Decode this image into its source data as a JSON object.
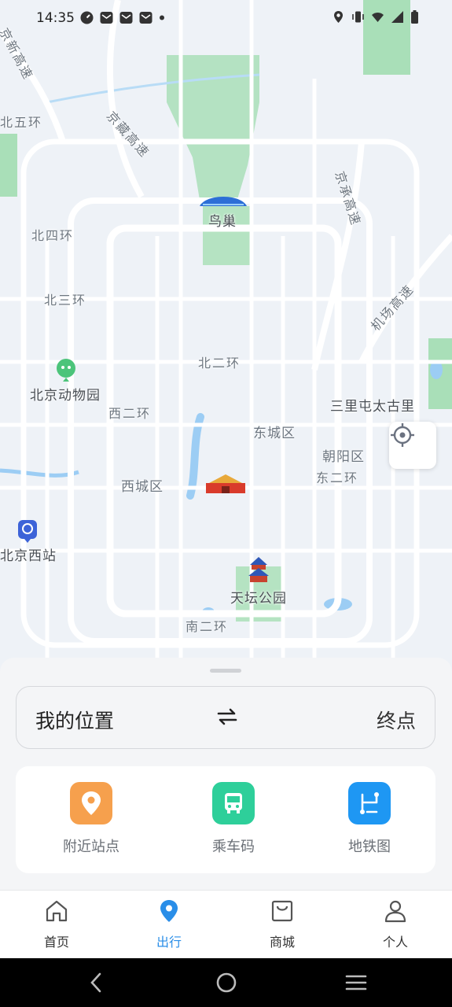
{
  "status_bar": {
    "time": "14:35",
    "left_icons": [
      "speedometer-icon",
      "mail-icon",
      "mail-icon",
      "mail-icon",
      "dot-icon"
    ],
    "right_icons": [
      "location-icon",
      "vibrate-icon",
      "wifi-icon",
      "signal-icon",
      "battery-icon"
    ]
  },
  "map": {
    "labels": {
      "bird_nest": "鸟巢",
      "zoo": "北京动物园",
      "dongcheng": "东城区",
      "xicheng": "西城区",
      "chaoyang": "朝阳区",
      "sanlitun": "三里屯太古里",
      "west_station": "北京西站",
      "temple_heaven": "天坛公园"
    },
    "roads": {
      "north5": "北五环",
      "north4": "北四环",
      "north3": "北三环",
      "north2": "北二环",
      "south2": "南二环",
      "west2": "西二环",
      "east2": "东二环",
      "jingzang": "京藏高速",
      "jingcheng": "京承高速",
      "airport": "机场高速",
      "jingxin": "京新高速"
    }
  },
  "sheet": {
    "from": "我的位置",
    "to": "终点",
    "quick": [
      {
        "label": "附近站点",
        "color": "#f6a04d",
        "icon": "location-pin-icon"
      },
      {
        "label": "乘车码",
        "color": "#2ecf9a",
        "icon": "bus-icon"
      },
      {
        "label": "地铁图",
        "color": "#1e97f3",
        "icon": "subway-map-icon"
      }
    ]
  },
  "tabs": [
    {
      "label": "首页",
      "icon": "home-icon",
      "active": false
    },
    {
      "label": "出行",
      "icon": "location-icon",
      "active": true
    },
    {
      "label": "商城",
      "icon": "shopping-bag-icon",
      "active": false
    },
    {
      "label": "个人",
      "icon": "user-icon",
      "active": false
    }
  ],
  "colors": {
    "accent": "#2a8ee8",
    "map_green": "#a9dfb8",
    "map_water": "#9ccdf4"
  }
}
